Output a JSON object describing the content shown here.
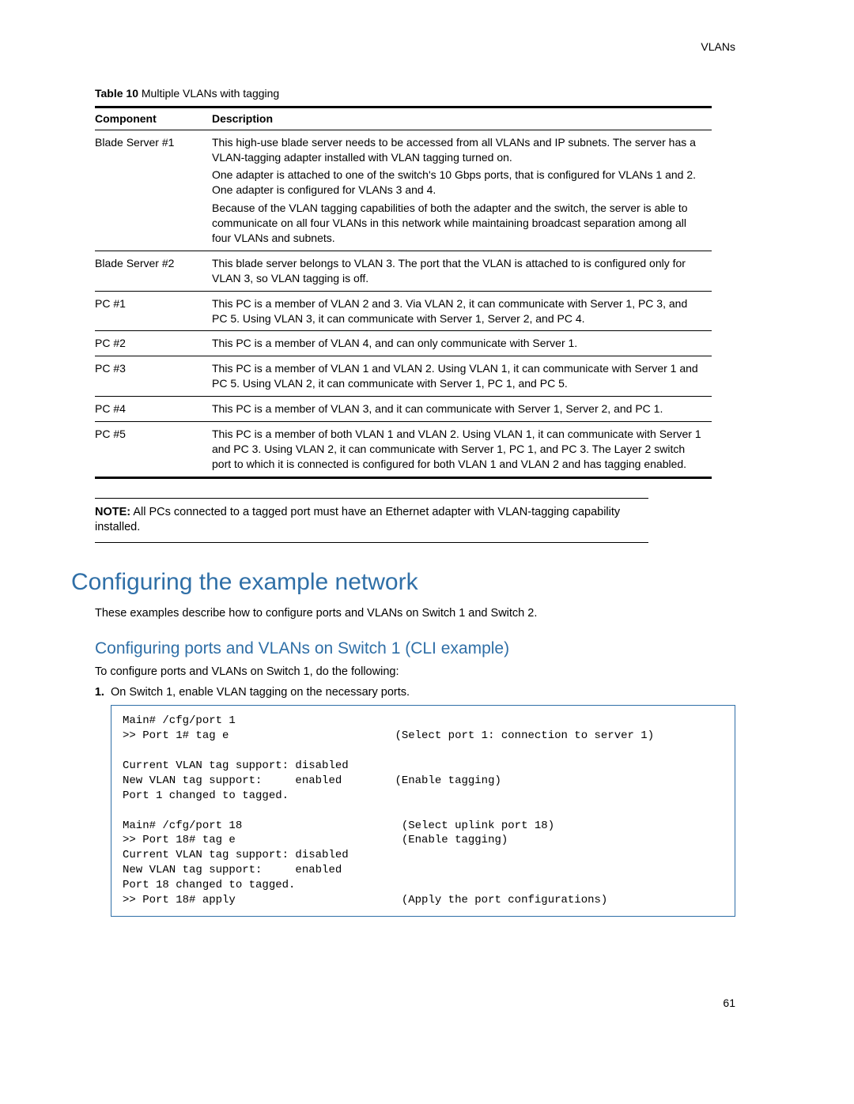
{
  "header": {
    "right": "VLANs"
  },
  "table": {
    "caption_label": "Table 10",
    "caption_text": " Multiple VLANs with tagging",
    "head_component": "Component",
    "head_description": "Description",
    "rows": [
      {
        "component": "Blade Server #1",
        "paras": [
          "This high-use blade server needs to be accessed from all VLANs and IP subnets. The server has a VLAN-tagging adapter installed with VLAN tagging turned on.",
          "One adapter is attached to one of the switch's 10 Gbps ports, that is configured for VLANs 1 and 2. One adapter is configured for VLANs 3 and 4.",
          "Because of the VLAN tagging capabilities of both the adapter and the switch, the server is able to communicate on all four VLANs in this network while maintaining broadcast separation among all four VLANs and subnets."
        ]
      },
      {
        "component": "Blade Server #2",
        "paras": [
          "This blade server belongs to VLAN 3. The port that the VLAN is attached to is configured only for VLAN 3, so VLAN tagging is off."
        ]
      },
      {
        "component": "PC #1",
        "paras": [
          "This PC is a member of VLAN 2 and 3. Via VLAN 2, it can communicate with Server 1, PC 3, and PC 5. Using VLAN 3, it can communicate with Server 1, Server 2, and PC 4."
        ]
      },
      {
        "component": "PC #2",
        "paras": [
          "This PC is a member of VLAN 4, and can only communicate with Server 1."
        ]
      },
      {
        "component": "PC #3",
        "paras": [
          "This PC is a member of VLAN 1 and VLAN 2. Using VLAN 1, it can communicate with Server 1 and PC 5. Using VLAN 2, it can communicate with Server 1, PC 1, and PC 5."
        ]
      },
      {
        "component": "PC #4",
        "paras": [
          "This PC is a member of VLAN 3, and it can communicate with Server 1, Server 2, and PC 1."
        ]
      },
      {
        "component": "PC #5",
        "paras": [
          "This PC is a member of both VLAN 1 and VLAN 2. Using VLAN 1, it can communicate with Server 1 and PC 3. Using VLAN 2, it can communicate with Server 1, PC 1, and PC 3. The Layer 2 switch port to which it is connected is configured for both VLAN 1 and VLAN 2 and has tagging enabled."
        ]
      }
    ]
  },
  "note": {
    "lead": "NOTE:",
    "text": " All PCs connected to a tagged port must have an Ethernet adapter with VLAN-tagging capability installed."
  },
  "h1": "Configuring the example network",
  "p1": "These examples describe how to configure ports and VLANs on Switch 1 and Switch 2.",
  "h2": "Configuring ports and VLANs on Switch 1 (CLI example)",
  "p2": "To configure ports and VLANs on Switch 1, do the following:",
  "step1": "On Switch 1, enable VLAN tagging on the necessary ports.",
  "cli": "Main# /cfg/port 1\n>> Port 1# tag e                         (Select port 1: connection to server 1)\n\nCurrent VLAN tag support: disabled\nNew VLAN tag support:     enabled        (Enable tagging)\nPort 1 changed to tagged.\n\nMain# /cfg/port 18                        (Select uplink port 18)\n>> Port 18# tag e                         (Enable tagging)\nCurrent VLAN tag support: disabled\nNew VLAN tag support:     enabled\nPort 18 changed to tagged.\n>> Port 18# apply                         (Apply the port configurations)",
  "page_number": "61"
}
